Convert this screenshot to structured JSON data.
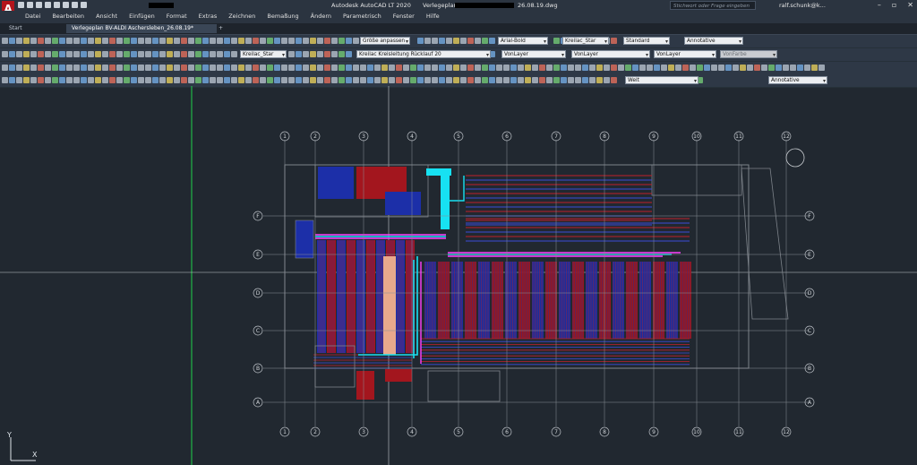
{
  "app": {
    "title": "Autodesk AutoCAD LT 2020",
    "file_prefix": "Verlegeplan BV-",
    "file_suffix": "26.08.19.dwg",
    "search_placeholder": "Stichwort oder Frage eingeben",
    "user": "ralf.schunk@k..."
  },
  "menu": [
    "Datei",
    "Bearbeiten",
    "Ansicht",
    "Einfügen",
    "Format",
    "Extras",
    "Zeichnen",
    "Bemaßung",
    "Ändern",
    "Parametrisch",
    "Fenster",
    "Hilfe"
  ],
  "tabs": {
    "start": "Start",
    "doc": "Verlegeplan BV-ALDI Aschersleben_26.08.19*",
    "plus": "+"
  },
  "toolbar": {
    "zoom_combo": "Größe anpassen",
    "text_style": "Arial-Bold",
    "dim_style": "Kreilac_Star",
    "table_style": "Standard",
    "annotative": "Annotative",
    "mleader_style": "Kreilac_Star",
    "layer": "Kreilac Kreisleitung Rücklauf 20",
    "color": "VonLayer",
    "linetype": "VonLayer",
    "lineweight": "VonLayer",
    "plotstyle": "VonFarbe",
    "dim_combo": "Weit",
    "annotative2": "Annotative"
  },
  "drawing": {
    "col_labels": [
      "1",
      "2",
      "3",
      "4",
      "5",
      "6",
      "7",
      "8",
      "9",
      "10",
      "11",
      "12"
    ],
    "row_labels": [
      "F",
      "E",
      "D",
      "C",
      "B",
      "A"
    ],
    "ucs_y": "Y",
    "ucs_x": "X",
    "colors": {
      "background": "#212830",
      "red": "#c0202a",
      "blue": "#1c2fa8",
      "cyan": "#17e1f2",
      "magenta": "#ff40ff",
      "grid": "#8a8f96",
      "green": "#1fd24a"
    }
  }
}
